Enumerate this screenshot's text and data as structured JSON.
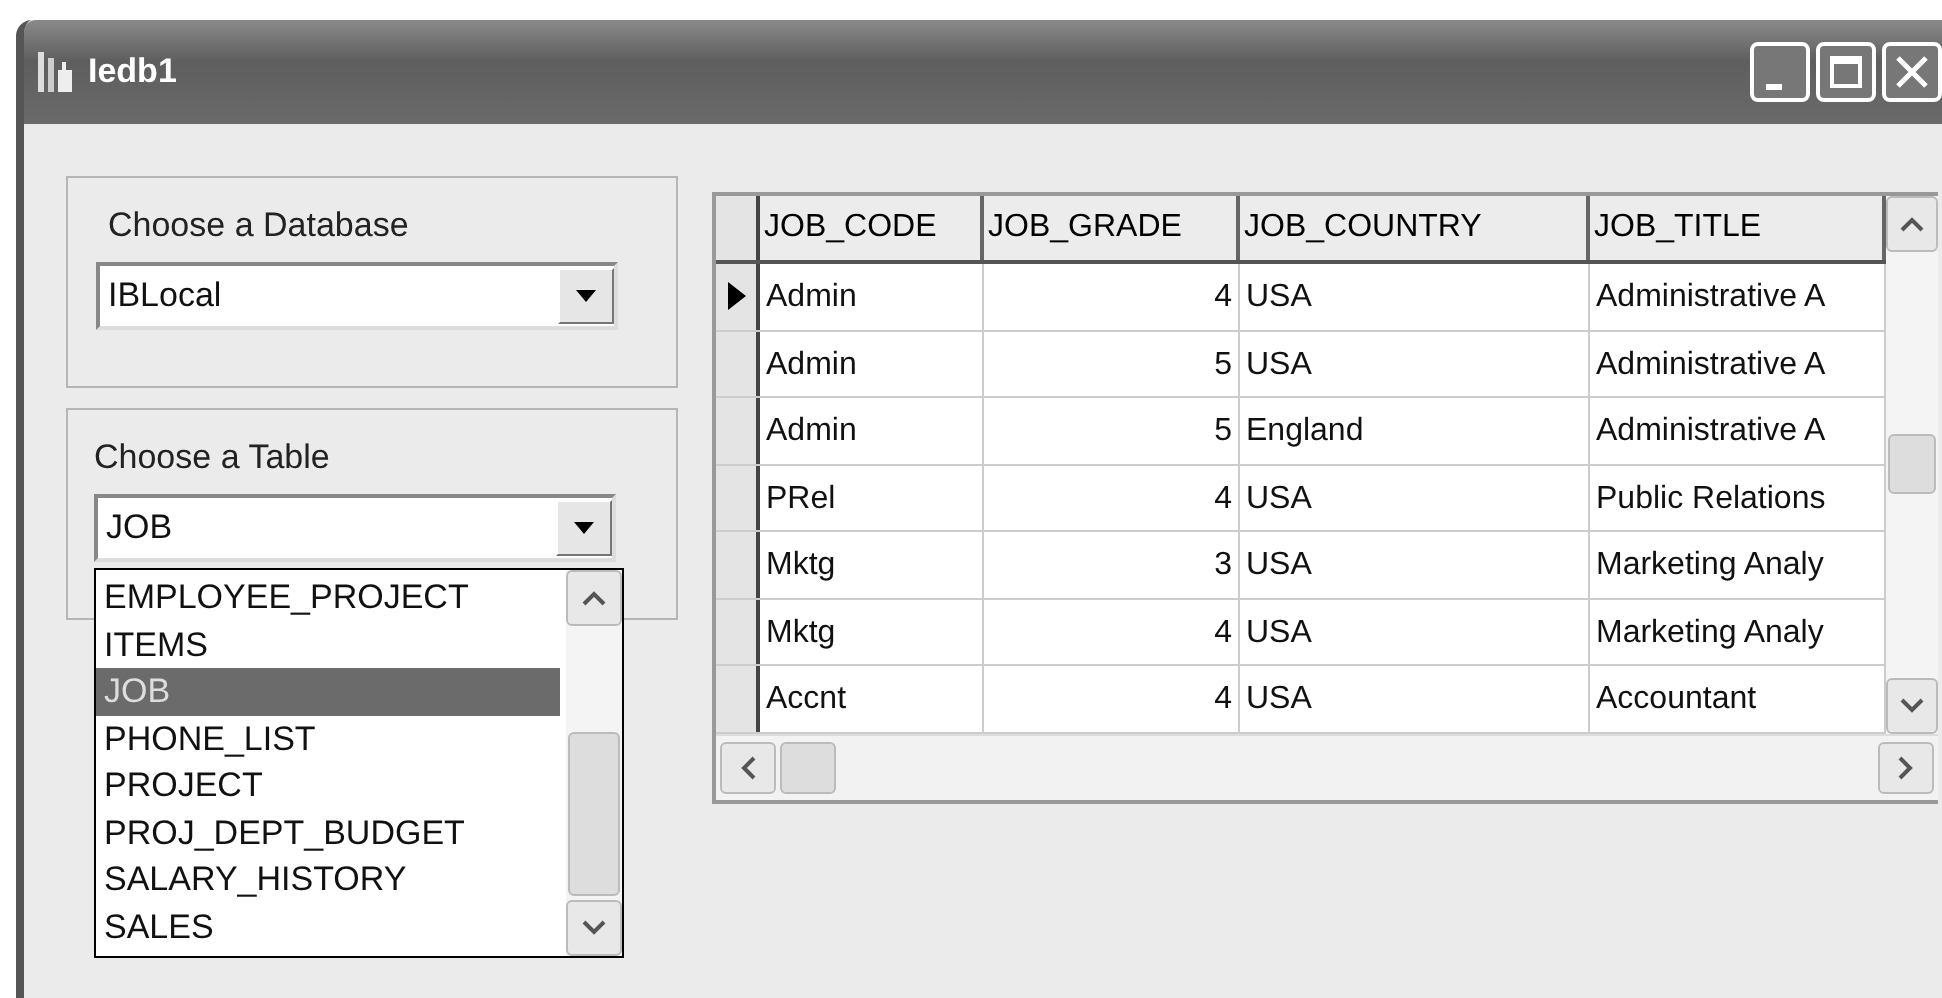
{
  "window": {
    "title": "Iedb1"
  },
  "database_group": {
    "label": "Choose a Database",
    "value": "IBLocal"
  },
  "table_group": {
    "label": "Choose a Table",
    "value": "JOB",
    "expanded": true,
    "options": [
      {
        "label": "EMPLOYEE_PROJECT",
        "selected": false
      },
      {
        "label": "ITEMS",
        "selected": false
      },
      {
        "label": "JOB",
        "selected": true
      },
      {
        "label": "PHONE_LIST",
        "selected": false
      },
      {
        "label": "PROJECT",
        "selected": false
      },
      {
        "label": "PROJ_DEPT_BUDGET",
        "selected": false
      },
      {
        "label": "SALARY_HISTORY",
        "selected": false
      },
      {
        "label": "SALES",
        "selected": false
      }
    ]
  },
  "table": {
    "columns": [
      "JOB_CODE",
      "JOB_GRADE",
      "JOB_COUNTRY",
      "JOB_TITLE"
    ],
    "rows": [
      {
        "current": true,
        "cells": [
          "Admin",
          "4",
          "USA",
          "Administrative A"
        ]
      },
      {
        "current": false,
        "cells": [
          "Admin",
          "5",
          "USA",
          "Administrative A"
        ]
      },
      {
        "current": false,
        "cells": [
          "Admin",
          "5",
          "England",
          "Administrative A"
        ]
      },
      {
        "current": false,
        "cells": [
          "PRel",
          "4",
          "USA",
          "Public Relations"
        ]
      },
      {
        "current": false,
        "cells": [
          "Mktg",
          "3",
          "USA",
          "Marketing Analy"
        ]
      },
      {
        "current": false,
        "cells": [
          "Mktg",
          "4",
          "USA",
          "Marketing Analy"
        ]
      },
      {
        "current": false,
        "cells": [
          "Accnt",
          "4",
          "USA",
          "Accountant"
        ]
      }
    ]
  }
}
